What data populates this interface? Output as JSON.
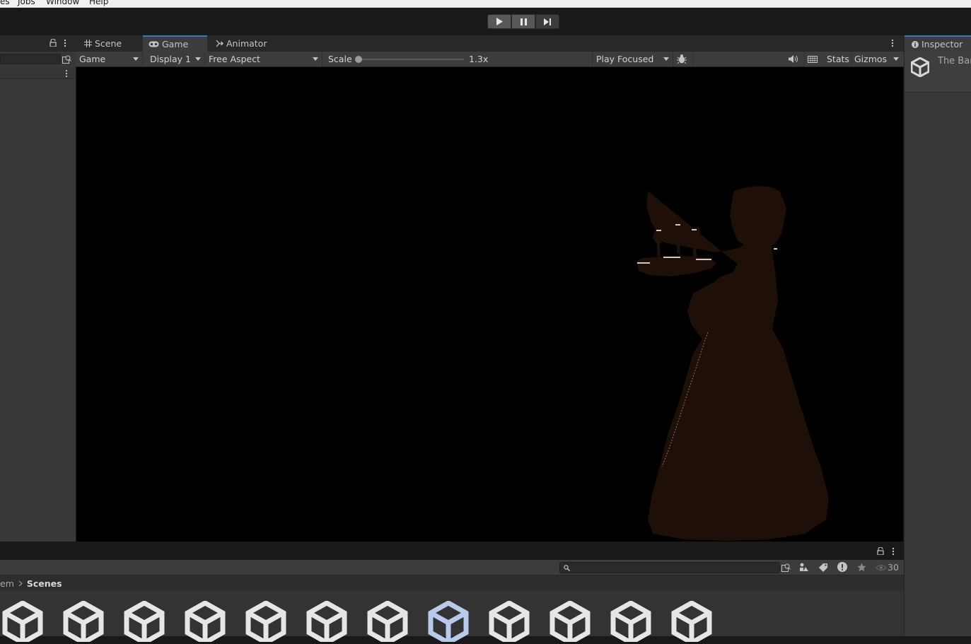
{
  "menubar": {
    "items": [
      "es",
      "Jobs",
      "Window",
      "Help"
    ]
  },
  "toolbar": {
    "play_icon": "play-icon",
    "pause_icon": "pause-icon",
    "step_icon": "step-icon"
  },
  "center": {
    "tabs": [
      {
        "label": "Scene",
        "icon": "grid-icon"
      },
      {
        "label": "Game",
        "icon": "gamepad-icon"
      },
      {
        "label": "Animator",
        "icon": "animator-icon"
      }
    ],
    "game_toolbar": {
      "view_mode": "Game",
      "display": "Display 1",
      "aspect": "Free Aspect",
      "scale_label": "Scale",
      "scale_value": "1.3x",
      "scale_fraction": 0.0,
      "play_mode": "Play Focused",
      "stats_label": "Stats",
      "gizmos_label": "Gizmos"
    }
  },
  "inspector": {
    "tab_label": "Inspector",
    "object_name": "The Bar"
  },
  "project": {
    "breadcrumb": [
      "em",
      "Scenes"
    ],
    "hidden_count": "30",
    "asset_count": 12,
    "selected_asset_index": 7
  },
  "colors": {
    "accent": "#3a79bb",
    "silhouette": "#1e0f08",
    "highlight": "#d8c5c0"
  }
}
